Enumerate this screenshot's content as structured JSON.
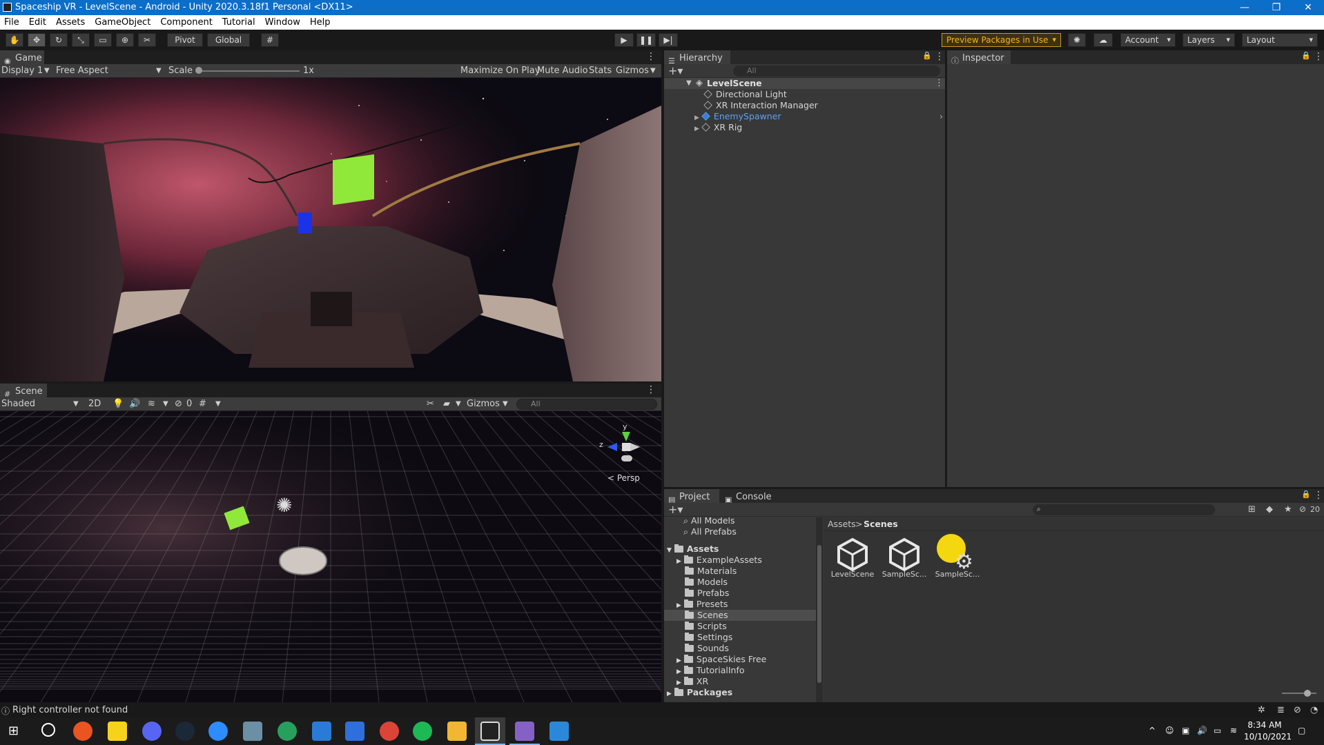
{
  "window": {
    "title": "Spaceship VR - LevelScene - Android - Unity 2020.3.18f1 Personal <DX11>"
  },
  "menu": [
    "File",
    "Edit",
    "Assets",
    "GameObject",
    "Component",
    "Tutorial",
    "Window",
    "Help"
  ],
  "toolbar": {
    "pivot": "Pivot",
    "global": "Global",
    "preview_packages": "Preview Packages in Use",
    "account": "Account",
    "layers": "Layers",
    "layout": "Layout"
  },
  "game": {
    "tab": "Game",
    "display": "Display 1",
    "aspect": "Free Aspect",
    "scale_label": "Scale",
    "scale_value": "1x",
    "maximize": "Maximize On Play",
    "mute": "Mute Audio",
    "stats": "Stats",
    "gizmos": "Gizmos"
  },
  "scene": {
    "tab": "Scene",
    "shading": "Shaded",
    "mode2d": "2D",
    "hidden_count": "0",
    "gizmos": "Gizmos",
    "search_placeholder": "All",
    "persp": "< Persp",
    "axis_y": "y",
    "axis_z": "z"
  },
  "hierarchy": {
    "tab": "Hierarchy",
    "search_placeholder": "All",
    "scene_name": "LevelScene",
    "items": [
      "Directional Light",
      "XR Interaction Manager",
      "EnemySpawner",
      "XR Rig"
    ]
  },
  "inspector": {
    "tab": "Inspector"
  },
  "project": {
    "tab": "Project",
    "console_tab": "Console",
    "hidden_count": "20",
    "favorites": [
      "All Models",
      "All Prefabs"
    ],
    "assets_root": "Assets",
    "folders": [
      "ExampleAssets",
      "Materials",
      "Models",
      "Prefabs",
      "Presets",
      "Scenes",
      "Scripts",
      "Settings",
      "Sounds",
      "SpaceSkies Free",
      "TutorialInfo",
      "XR"
    ],
    "packages": "Packages",
    "breadcrumb_root": "Assets",
    "breadcrumb_sep": ">",
    "breadcrumb_current": "Scenes",
    "files": [
      "LevelScene",
      "SampleSc...",
      "SampleSc..."
    ]
  },
  "status": {
    "message": "Right controller not found"
  },
  "taskbar": {
    "time": "8:34 AM",
    "date": "10/10/2021"
  },
  "colors": {
    "titlebar": "#0b6ec9",
    "preview_warning": "#f3b51a",
    "enemy_spawner": "#5ba3f5",
    "green_cube": "#8fe83a"
  }
}
